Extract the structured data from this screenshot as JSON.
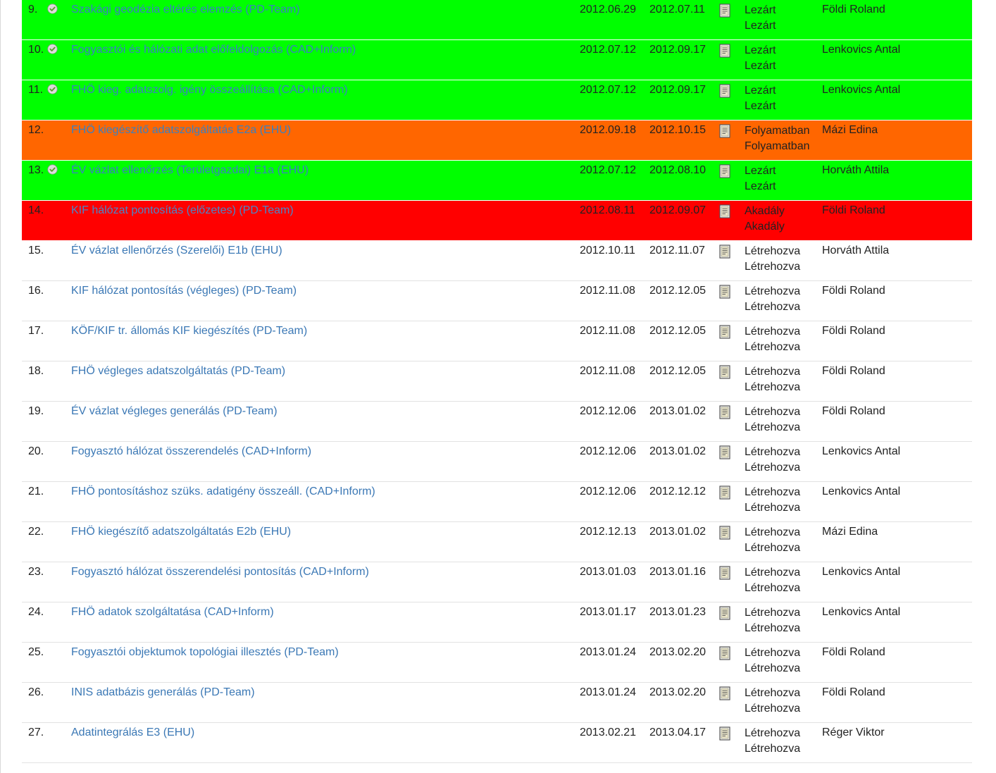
{
  "tasks": [
    {
      "num": "9.",
      "done": true,
      "title": "Szakági geodézia eltérés elemzés (PD-Team)",
      "start": "2012.06.29",
      "end": "2012.07.11",
      "status": "Lezárt",
      "status2": "Lezárt",
      "owner": "Földi Roland",
      "row_color": "#00ff00"
    },
    {
      "num": "10.",
      "done": true,
      "title": "Fogyasztói és hálózati adat előfeldolgozás (CAD+Inform)",
      "start": "2012.07.12",
      "end": "2012.09.17",
      "status": "Lezárt",
      "status2": "Lezárt",
      "owner": "Lenkovics Antal",
      "row_color": "#00ff00"
    },
    {
      "num": "11.",
      "done": true,
      "title": "FHÖ kieg. adatszolg. igény összeállítása (CAD+Inform)",
      "start": "2012.07.12",
      "end": "2012.09.17",
      "status": "Lezárt",
      "status2": "Lezárt",
      "owner": "Lenkovics Antal",
      "row_color": "#00ff00"
    },
    {
      "num": "12.",
      "done": false,
      "title": "FHÖ kiegészítő adatszolgáltatás E2a (EHU)",
      "start": "2012.09.18",
      "end": "2012.10.15",
      "status": "Folyamatban",
      "status2": "Folyamatban",
      "owner": "Mázi Edina",
      "row_color": "#ff6600"
    },
    {
      "num": "13.",
      "done": true,
      "title": "ÉV vázlat ellenőrzés (Területgazdai) E1a (EHU)",
      "start": "2012.07.12",
      "end": "2012.08.10",
      "status": "Lezárt",
      "status2": "Lezárt",
      "owner": "Horváth Attila",
      "row_color": "#00ff00"
    },
    {
      "num": "14.",
      "done": false,
      "title": "KIF hálózat pontosítás (előzetes) (PD-Team)",
      "start": "2012.08.11",
      "end": "2012.09.07",
      "status": "Akadály",
      "status2": "Akadály",
      "owner": "Földi Roland",
      "row_color": "#ff0000"
    },
    {
      "num": "15.",
      "done": false,
      "title": "ÉV vázlat ellenőrzés (Szerelői) E1b (EHU)",
      "start": "2012.10.11",
      "end": "2012.11.07",
      "status": "Létrehozva",
      "status2": "Létrehozva",
      "owner": "Horváth Attila",
      "row_color": ""
    },
    {
      "num": "16.",
      "done": false,
      "title": "KIF hálózat pontosítás (végleges) (PD-Team)",
      "start": "2012.11.08",
      "end": "2012.12.05",
      "status": "Létrehozva",
      "status2": "Létrehozva",
      "owner": "Földi Roland",
      "row_color": ""
    },
    {
      "num": "17.",
      "done": false,
      "title": "KÖF/KIF tr. állomás KIF kiegészítés (PD-Team)",
      "start": "2012.11.08",
      "end": "2012.12.05",
      "status": "Létrehozva",
      "status2": "Létrehozva",
      "owner": "Földi Roland",
      "row_color": ""
    },
    {
      "num": "18.",
      "done": false,
      "title": "FHÖ végleges adatszolgáltatás (PD-Team)",
      "start": "2012.11.08",
      "end": "2012.12.05",
      "status": "Létrehozva",
      "status2": "Létrehozva",
      "owner": "Földi Roland",
      "row_color": ""
    },
    {
      "num": "19.",
      "done": false,
      "title": "ÉV vázlat végleges generálás (PD-Team)",
      "start": "2012.12.06",
      "end": "2013.01.02",
      "status": "Létrehozva",
      "status2": "Létrehozva",
      "owner": "Földi Roland",
      "row_color": ""
    },
    {
      "num": "20.",
      "done": false,
      "title": "Fogyasztó hálózat összerendelés (CAD+Inform)",
      "start": "2012.12.06",
      "end": "2013.01.02",
      "status": "Létrehozva",
      "status2": "Létrehozva",
      "owner": "Lenkovics Antal",
      "row_color": ""
    },
    {
      "num": "21.",
      "done": false,
      "title": "FHÖ pontosításhoz szüks. adatigény összeáll. (CAD+Inform)",
      "start": "2012.12.06",
      "end": "2012.12.12",
      "status": "Létrehozva",
      "status2": "Létrehozva",
      "owner": "Lenkovics Antal",
      "row_color": ""
    },
    {
      "num": "22.",
      "done": false,
      "title": "FHÖ kiegészítő adatszolgáltatás E2b (EHU)",
      "start": "2012.12.13",
      "end": "2013.01.02",
      "status": "Létrehozva",
      "status2": "Létrehozva",
      "owner": "Mázi Edina",
      "row_color": ""
    },
    {
      "num": "23.",
      "done": false,
      "title": "Fogyasztó hálózat összerendelési pontosítás (CAD+Inform)",
      "start": "2013.01.03",
      "end": "2013.01.16",
      "status": "Létrehozva",
      "status2": "Létrehozva",
      "owner": "Lenkovics Antal",
      "row_color": ""
    },
    {
      "num": "24.",
      "done": false,
      "title": "FHÖ adatok szolgáltatása (CAD+Inform)",
      "start": "2013.01.17",
      "end": "2013.01.23",
      "status": "Létrehozva",
      "status2": "Létrehozva",
      "owner": "Lenkovics Antal",
      "row_color": ""
    },
    {
      "num": "25.",
      "done": false,
      "title": "Fogyasztói objektumok topológiai illesztés (PD-Team)",
      "start": "2013.01.24",
      "end": "2013.02.20",
      "status": "Létrehozva",
      "status2": "Létrehozva",
      "owner": "Földi Roland",
      "row_color": ""
    },
    {
      "num": "26.",
      "done": false,
      "title": "INIS adatbázis generálás (PD-Team)",
      "start": "2013.01.24",
      "end": "2013.02.20",
      "status": "Létrehozva",
      "status2": "Létrehozva",
      "owner": "Földi Roland",
      "row_color": ""
    },
    {
      "num": "27.",
      "done": false,
      "title": "Adatintegrálás E3 (EHU)",
      "start": "2013.02.21",
      "end": "2013.04.17",
      "status": "Létrehozva",
      "status2": "Létrehozva",
      "owner": "Réger Viktor",
      "row_color": ""
    }
  ],
  "icons": {
    "done": "check-circle-icon",
    "doc": "document-icon"
  },
  "colors": {
    "link": "#3b78b5",
    "done": "#00ff00",
    "in_progress": "#ff6600",
    "blocked": "#ff0000"
  }
}
